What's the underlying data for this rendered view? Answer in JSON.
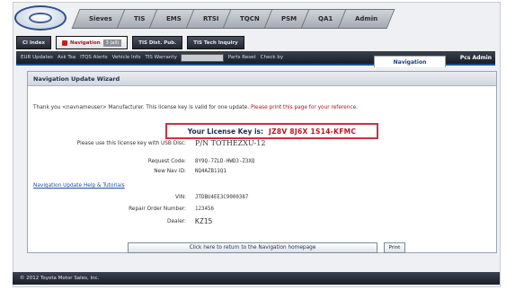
{
  "top_tabs": [
    "Sieves",
    "TIS",
    "EMS",
    "RTSI",
    "TQCN",
    "PSM",
    "QA1",
    "Admin"
  ],
  "sub_tabs": [
    {
      "label": "Cl Index",
      "count": "",
      "active": false
    },
    {
      "label": "Navigation",
      "count": "3 (all)",
      "active": true
    },
    {
      "label": "TIS Dist. Pub.",
      "count": "",
      "active": false
    },
    {
      "label": "TIS Tech Inquiry",
      "count": "",
      "active": false
    }
  ],
  "nav_bar": {
    "links": [
      "EUR Updates",
      "Ask Tsa",
      "ITQS Alerts",
      "Vehicle Info",
      "TIS Warranty",
      "Parts Reset",
      "Check by"
    ],
    "active_tab": "Navigation",
    "right_command": "Pcs Admin"
  },
  "panel": {
    "title": "Navigation Update Wizard",
    "intro_text": "Thank you <navnameuser> Manufacturer.  This license key is valid for one update.",
    "intro_red": "Please print this page for your reference."
  },
  "license": {
    "label": "Your License Key is:",
    "value": "JZ8V 8J6X 1S14-KFMC"
  },
  "rows": {
    "use_with": {
      "label": "Please use this license key with USB Disc:",
      "value": "P/N  TOTHEZXU-12"
    },
    "request_code": {
      "label": "Request Code:",
      "value": "8Y9Q-7ZLD-HWD3-Z3XQ"
    },
    "nav_id": {
      "label": "New Nav ID:",
      "value": "NQ4AZB11Q1"
    },
    "vin": {
      "label": "VIN:",
      "value": "JTDBU4EE3C9000387"
    },
    "repair_order": {
      "label": "Repair Order Number:",
      "value": "123456"
    },
    "dealer": {
      "label": "Dealer:",
      "value": "KZ15"
    }
  },
  "help_link": "Navigation Update Help & Tutorials",
  "buttons": {
    "return": "Click here to return to the Navigation homepage",
    "print": "Print"
  },
  "footer": "© 2012 Toyota Motor Sales, Inc."
}
